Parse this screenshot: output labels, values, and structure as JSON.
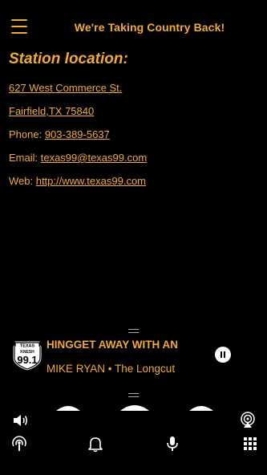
{
  "header": {
    "title": "We're Taking Country Back!",
    "menu_icon": "hamburger-menu-icon"
  },
  "section": {
    "title": "Station location:"
  },
  "contact": {
    "address_line1": "627 West Commerce St.",
    "address_line2": "Fairfield,TX 75840",
    "phone_label": "Phone: ",
    "phone": "903-389-5637",
    "email_label": "Email: ",
    "email": "texas99@texas99.com",
    "web_label": "Web: ",
    "web": "http://www.texas99.com"
  },
  "player": {
    "title": "HINGGET AWAY WITH AN",
    "artist": "MIKE RYAN",
    "separator": " • ",
    "album": "The Longcut",
    "logo_text_top": "TEXAS",
    "logo_text_mid": "KNESH",
    "logo_text_num": "99.1",
    "state": "playing"
  },
  "toolbar": {
    "row1": [
      "volume-icon",
      "airplay-icon"
    ],
    "row2": [
      "podcast-icon",
      "bell-icon",
      "microphone-icon",
      "grid-icon"
    ]
  },
  "colors": {
    "accent": "#f2a93b",
    "background": "#000000"
  }
}
